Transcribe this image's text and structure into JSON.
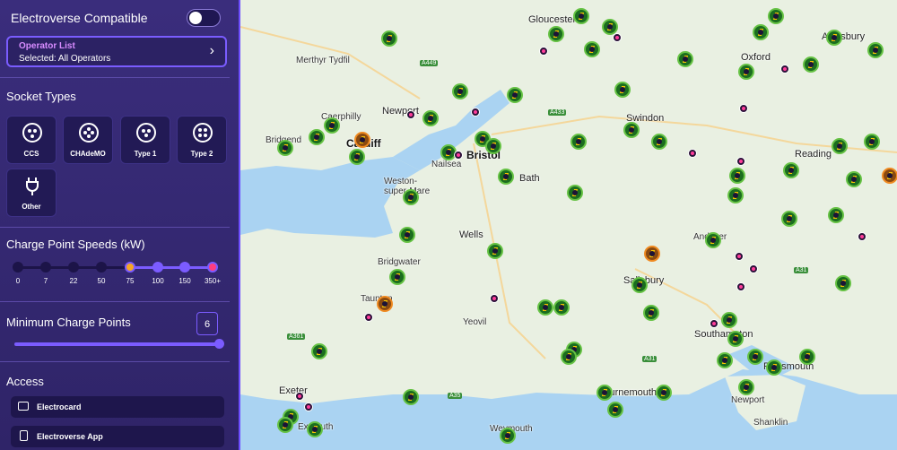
{
  "sidebar": {
    "compat_label": "Electroverse Compatible",
    "operator_title": "Operator List",
    "operator_selected": "Selected: All Operators",
    "operator_chevron": "›",
    "socket_title": "Socket Types",
    "sockets": [
      {
        "label": "CCS"
      },
      {
        "label": "CHAdeMO"
      },
      {
        "label": "Type 1"
      },
      {
        "label": "Type 2"
      },
      {
        "label": "Other"
      }
    ],
    "speed_title": "Charge Point Speeds (kW)",
    "speed_ticks": [
      "0",
      "7",
      "22",
      "50",
      "75",
      "100",
      "150",
      "350+"
    ],
    "min_title": "Minimum Charge Points",
    "min_value": "6",
    "access_title": "Access",
    "access": [
      {
        "label": "Electrocard"
      },
      {
        "label": "Electroverse App"
      }
    ]
  },
  "map": {
    "places": [
      {
        "name": "Gloucester",
        "cls": "city"
      },
      {
        "name": "Aylesbury",
        "cls": "city"
      },
      {
        "name": "Oxford",
        "cls": "city"
      },
      {
        "name": "Merthyr Tydfil",
        "cls": ""
      },
      {
        "name": "Newport",
        "cls": "city"
      },
      {
        "name": "Caerphilly",
        "cls": ""
      },
      {
        "name": "Cardiff",
        "cls": "bigcity"
      },
      {
        "name": "Bridgend",
        "cls": ""
      },
      {
        "name": "Bristol",
        "cls": "bigcity"
      },
      {
        "name": "Nailsea",
        "cls": ""
      },
      {
        "name": "Weston-super-Mare",
        "cls": ""
      },
      {
        "name": "Bath",
        "cls": "city"
      },
      {
        "name": "Swindon",
        "cls": "city"
      },
      {
        "name": "Reading",
        "cls": "city"
      },
      {
        "name": "Wells",
        "cls": "city"
      },
      {
        "name": "Andover",
        "cls": ""
      },
      {
        "name": "Bridgwater",
        "cls": ""
      },
      {
        "name": "Salisbury",
        "cls": "city"
      },
      {
        "name": "Taunton",
        "cls": ""
      },
      {
        "name": "Yeovil",
        "cls": ""
      },
      {
        "name": "Southampton",
        "cls": "city"
      },
      {
        "name": "Portsmouth",
        "cls": "city"
      },
      {
        "name": "Exeter",
        "cls": "city"
      },
      {
        "name": "Bournemouth",
        "cls": "city"
      },
      {
        "name": "Newport",
        "cls": ""
      },
      {
        "name": "Exmouth",
        "cls": ""
      },
      {
        "name": "Weymouth",
        "cls": ""
      },
      {
        "name": "Shanklin",
        "cls": ""
      }
    ],
    "roads": [
      "A449",
      "A433",
      "A31",
      "A361",
      "A35",
      "A31"
    ]
  }
}
